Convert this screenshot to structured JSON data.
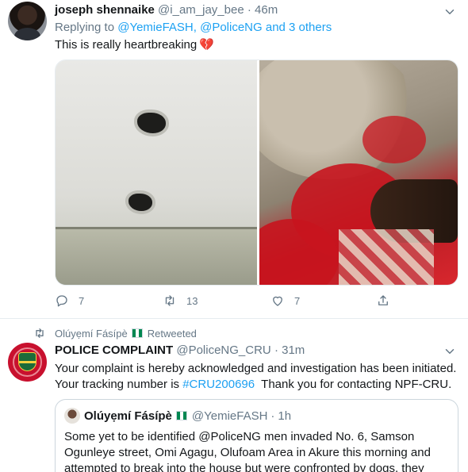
{
  "tweet1": {
    "name": "joseph shennaike",
    "handle": "@i_am_jay_bee",
    "separator": "·",
    "time": "46m",
    "replying_prefix": "Replying to ",
    "replying_to": "@YemieFASH, @PoliceNG and 3 others",
    "text": "This is really heartbreaking",
    "emoji": "💔",
    "actions": {
      "reply_count": "7",
      "retweet_count": "13",
      "like_count": "7"
    }
  },
  "retweet_context": {
    "user": "Olúyẹmí Fásípè",
    "label": "Retweeted"
  },
  "tweet2": {
    "name": "POLICE COMPLAINT",
    "handle": "@PoliceNG_CRU",
    "separator": "·",
    "time": "31m",
    "line1": "Your complaint is hereby acknowledged and investigation has been initiated.",
    "line2_prefix": "Your tracking number is ",
    "tracking_hashtag": "#CRU200696",
    "line2_suffix": "  Thank you for contacting NPF-CRU.",
    "quote": {
      "name": "Olúyẹmí Fásípè",
      "handle": "@YemieFASH",
      "separator": "·",
      "time": "1h",
      "text": "Some yet to be identified @PoliceNG men invaded No. 6, Samson Ogunleye street, Omi Agagu, Olufoam Area in Akure this morning and attempted to break into the house but were confronted by dogs, they"
    }
  },
  "colors": {
    "link": "#1da1f2",
    "secondary_text": "#657786",
    "like_heart": "#e0245e"
  }
}
